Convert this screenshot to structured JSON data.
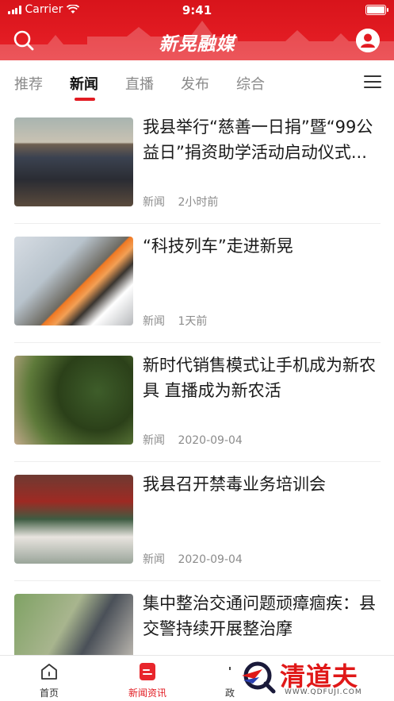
{
  "status_bar": {
    "carrier": "Carrier",
    "time": "9:41"
  },
  "header": {
    "logo": "新晃融媒",
    "search_icon": "search-icon",
    "user_icon": "user-icon"
  },
  "tabs": [
    {
      "label": "推荐",
      "active": false
    },
    {
      "label": "新闻",
      "active": true
    },
    {
      "label": "直播",
      "active": false
    },
    {
      "label": "发布",
      "active": false
    },
    {
      "label": "综合",
      "active": false
    }
  ],
  "news": [
    {
      "title": "我县举行“慈善一日捐”暨“99公益日”捐资助学活动启动仪式...",
      "category": "新闻",
      "time": "2小时前"
    },
    {
      "title": "“科技列车”走进新晃",
      "category": "新闻",
      "time": "1天前"
    },
    {
      "title": "新时代销售模式让手机成为新农具 直播成为新农活",
      "category": "新闻",
      "time": "2020-09-04"
    },
    {
      "title": "我县召开禁毒业务培训会",
      "category": "新闻",
      "time": "2020-09-04"
    },
    {
      "title": "集中整治交通问题顽瘴痼疾：县交警持续开展整治摩",
      "category": "",
      "time": ""
    }
  ],
  "bottom_nav": [
    {
      "label": "首页",
      "icon": "home-icon",
      "active": false
    },
    {
      "label": "新闻资讯",
      "icon": "news-icon",
      "active": true
    },
    {
      "label": "政",
      "icon": "gov-icon",
      "active": false
    }
  ],
  "watermark": {
    "text": "清道夫",
    "sub": "WWW.QDFUJI.COM"
  },
  "colors": {
    "brand_red": "#e21b22",
    "text_gray": "#8c8c8c"
  }
}
